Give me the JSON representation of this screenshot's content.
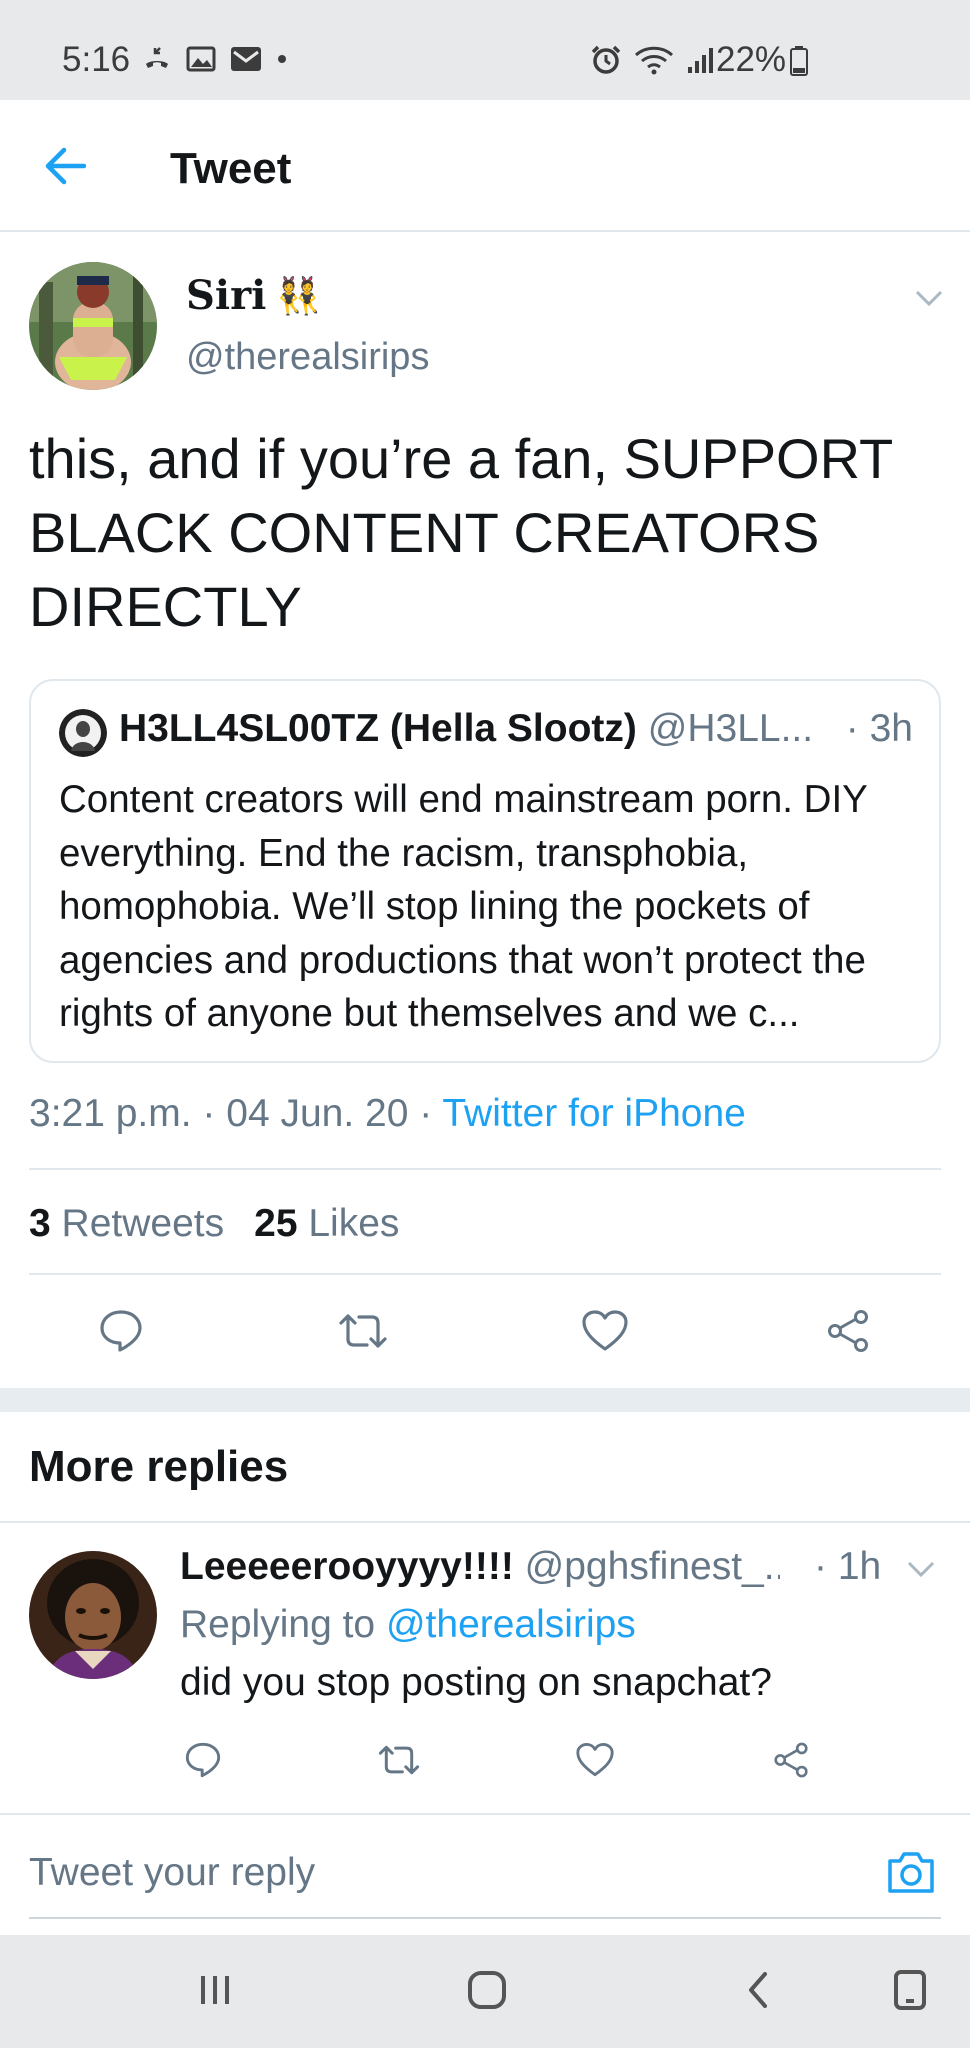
{
  "status_bar": {
    "time": "5:16",
    "battery": "22%"
  },
  "header": {
    "title": "Tweet"
  },
  "tweet": {
    "author_name": "Siri",
    "author_emoji": "👯",
    "author_handle": "@therealsirips",
    "text": "this, and if you’re a fan, SUPPORT BLACK CONTENT CREATORS DIRECTLY",
    "quote": {
      "name": "H3LL4SL00TZ (Hella Slootz)",
      "handle": "@H3LL...",
      "time": "· 3h",
      "text": "Content creators will end mainstream porn. DIY everything. End the racism, transphobia, homophobia. We’ll stop lining the pockets of agencies and productions that won’t protect the rights of anyone but themselves and we c..."
    },
    "time": "3:21 p.m.",
    "date": "04 Jun. 20",
    "separator": " · ",
    "source": "Twitter for iPhone",
    "retweet_count": "3",
    "retweet_label": "Retweets",
    "like_count": "25",
    "like_label": "Likes"
  },
  "more_replies": {
    "title": "More replies"
  },
  "reply": {
    "name": "Leeeeerooyyyy!!!!",
    "handle": "@pghsfinest_...",
    "time": "· 1h",
    "replying_prefix": "Replying to ",
    "replying_to": "@therealsirips",
    "text": "did you stop posting on snapchat?"
  },
  "compose": {
    "placeholder": "Tweet your reply"
  },
  "colors": {
    "accent": "#1da1f2",
    "secondary_text": "#657786",
    "primary_text": "#14171a",
    "divider": "#e1e8ed"
  },
  "icons": {
    "back": "arrow-left-icon",
    "reply": "speech-bubble-icon",
    "retweet": "retweet-icon",
    "like": "heart-icon",
    "share": "share-icon",
    "camera": "camera-icon"
  }
}
